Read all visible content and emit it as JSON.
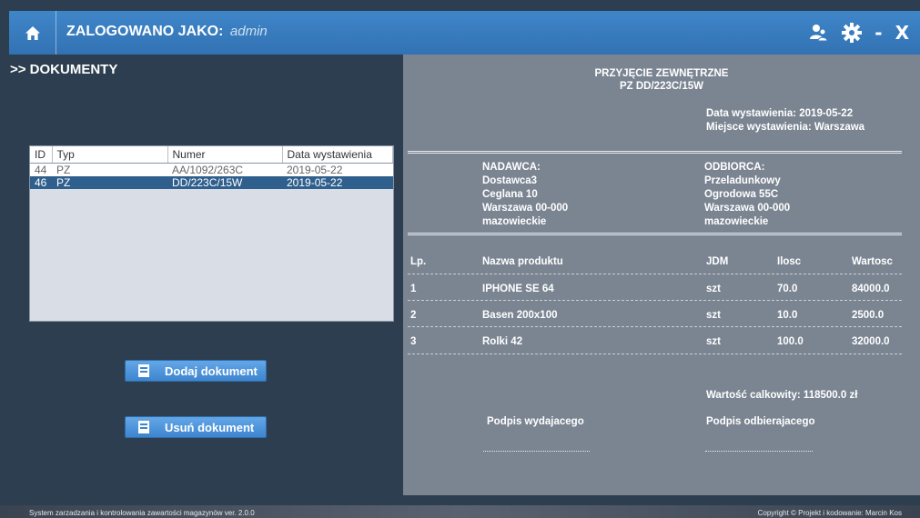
{
  "header": {
    "title_label": "ZALOGOWANO JAKO:",
    "user": "admin",
    "minimize_label": "-",
    "close_label": "X"
  },
  "icons": [
    "home-icon",
    "users-icon",
    "gear-icon"
  ],
  "section_title": ">> DOKUMENTY",
  "table": {
    "columns": [
      "ID",
      "Typ",
      "Numer",
      "Data wystawienia"
    ],
    "rows": [
      {
        "id": "44",
        "typ": "PZ",
        "numer": "AA/1092/263C",
        "data": "2019-05-22"
      },
      {
        "id": "46",
        "typ": "PZ",
        "numer": "DD/223C/15W",
        "data": "2019-05-22"
      }
    ],
    "selected_index": 1
  },
  "buttons": {
    "add": "Dodaj dokument",
    "remove": "Usuń dokument"
  },
  "document": {
    "type": "PRZYJĘCIE ZEWNĘTRZNE",
    "number": "PZ DD/223C/15W",
    "issue_date": "Data wystawienia: 2019-05-22",
    "issue_place": "Miejsce wystawienia: Warszawa",
    "sender": {
      "label": "NADAWCA:",
      "name": "Dostawca3",
      "street": "Ceglana 10",
      "city": "Warszawa 00-000",
      "region": "mazowieckie"
    },
    "receiver": {
      "label": "ODBIORCA:",
      "name": "Przeladunkowy",
      "street": "Ogrodowa 55C",
      "city": "Warszawa 00-000",
      "region": "mazowieckie"
    },
    "columns": [
      "Lp.",
      "Nazwa produktu",
      "JDM",
      "Ilosc",
      "Wartosc"
    ],
    "items": [
      {
        "lp": "1",
        "name": "IPHONE SE 64",
        "jdm": "szt",
        "qty": "70.0",
        "value": "84000.0"
      },
      {
        "lp": "2",
        "name": "Basen 200x100",
        "jdm": "szt",
        "qty": "10.0",
        "value": "2500.0"
      },
      {
        "lp": "3",
        "name": "Rolki 42",
        "jdm": "szt",
        "qty": "100.0",
        "value": "32000.0"
      }
    ],
    "total": "Wartość calkowity: 118500.0 zł",
    "sig_issuer": "Podpis wydajacego",
    "sig_receiver": "Podpis odbierajacego"
  },
  "footer": {
    "left": "System zarzadzania i kontrolowania zawartości magazynów ver. 2.0.0",
    "right": "Copyright © Projekt i kodowanie: Marcin Kos"
  },
  "colors": {
    "background": "#2c3e50",
    "topbar": "#3a7ec1",
    "selected_row": "#2f5f8c",
    "document_bg": "#7b8592",
    "button": "#4a90d9"
  }
}
